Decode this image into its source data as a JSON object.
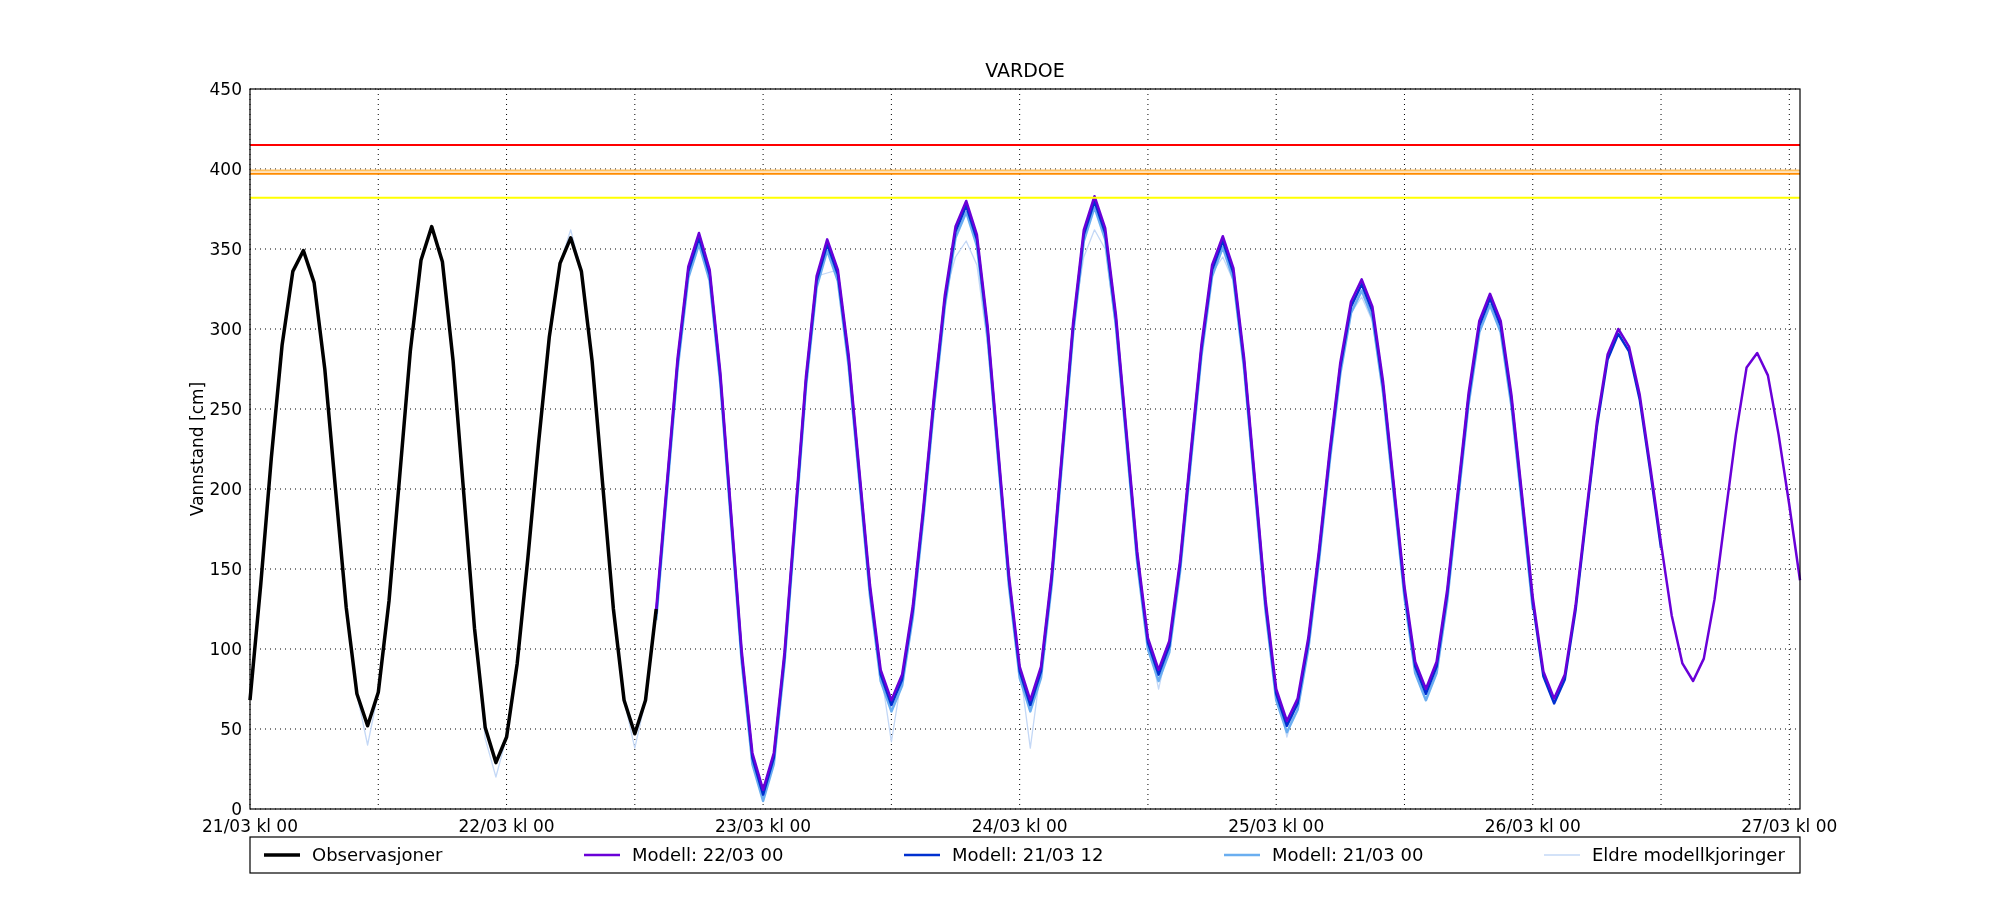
{
  "chart_data": {
    "type": "line",
    "title": "VARDOE",
    "ylabel": "Vannstand [cm]",
    "categories": [
      "21/03 kl 00",
      null,
      null,
      null,
      null,
      null,
      null,
      null,
      null,
      null,
      null,
      null,
      null,
      null,
      null,
      null,
      null,
      null,
      null,
      null,
      null,
      null,
      null,
      null,
      "22/03 kl 00",
      null,
      null,
      null,
      null,
      null,
      null,
      null,
      null,
      null,
      null,
      null,
      null,
      null,
      null,
      null,
      null,
      null,
      null,
      null,
      null,
      null,
      null,
      null,
      "23/03 kl 00",
      null,
      null,
      null,
      null,
      null,
      null,
      null,
      null,
      null,
      null,
      null,
      null,
      null,
      null,
      null,
      null,
      null,
      null,
      null,
      null,
      null,
      null,
      null,
      "24/03 kl 00",
      null,
      null,
      null,
      null,
      null,
      null,
      null,
      null,
      null,
      null,
      null,
      null,
      null,
      null,
      null,
      null,
      null,
      null,
      null,
      null,
      null,
      null,
      null,
      "25/03 kl 00",
      null,
      null,
      null,
      null,
      null,
      null,
      null,
      null,
      null,
      null,
      null,
      null,
      null,
      null,
      null,
      null,
      null,
      null,
      null,
      null,
      null,
      null,
      null,
      "26/03 kl 00",
      null,
      null,
      null,
      null,
      null,
      null,
      null,
      null,
      null,
      null,
      null,
      null,
      null,
      null,
      null,
      null,
      null,
      null,
      null,
      null,
      null,
      null,
      null,
      "27/03 kl 00",
      null
    ],
    "ylim": [
      0,
      450
    ],
    "yticks": [
      0,
      50,
      100,
      150,
      200,
      250,
      300,
      350,
      400,
      450
    ],
    "grid": true,
    "legend": "below",
    "ref_lines": [
      {
        "axis": "y",
        "value": 415,
        "color": "#ff0000"
      },
      {
        "axis": "y",
        "value": 399,
        "color": "#ffc060"
      },
      {
        "axis": "y",
        "value": 397,
        "color": "#ff8c00"
      },
      {
        "axis": "y",
        "value": 382,
        "color": "#ffff00"
      }
    ],
    "series": [
      {
        "name": "Observasjoner",
        "color": "#000000",
        "values": [
          68,
          140,
          220,
          290,
          336,
          349,
          329,
          275,
          200,
          126,
          72,
          52,
          73,
          130,
          208,
          286,
          343,
          364,
          342,
          280,
          197,
          113,
          51,
          29,
          45,
          91,
          157,
          229,
          295,
          341,
          357,
          336,
          280,
          202,
          125,
          68,
          47,
          68,
          125,
          null,
          null,
          null,
          null,
          null,
          null,
          null,
          null,
          null,
          null,
          null,
          null,
          null,
          null,
          null,
          null,
          null,
          null,
          null,
          null,
          null,
          null,
          null,
          null,
          null,
          null,
          null,
          null,
          null,
          null,
          null,
          null,
          null,
          null,
          null,
          null,
          null,
          null,
          null,
          null,
          null,
          null,
          null,
          null,
          null,
          null,
          null,
          null,
          null,
          null,
          null,
          null,
          null,
          null,
          null,
          null,
          null,
          null,
          null,
          null,
          null,
          null,
          null,
          null,
          null,
          null,
          null,
          null,
          null,
          null,
          null,
          null,
          null,
          null,
          null,
          null,
          null,
          null,
          null,
          null,
          null,
          null,
          null,
          null,
          null,
          null,
          null,
          null,
          null,
          null,
          null,
          null,
          null,
          null,
          null,
          null,
          null,
          null,
          null,
          null,
          null,
          null,
          null,
          null,
          null,
          null,
          null
        ]
      },
      {
        "name": "Modell: 22/03 00",
        "color": "#6a00d8",
        "values": [
          null,
          null,
          null,
          null,
          null,
          null,
          null,
          null,
          null,
          null,
          null,
          null,
          null,
          null,
          null,
          null,
          null,
          null,
          null,
          null,
          null,
          null,
          null,
          null,
          null,
          null,
          null,
          null,
          null,
          null,
          null,
          null,
          null,
          null,
          null,
          null,
          null,
          null,
          125,
          204,
          282,
          339,
          360,
          337,
          273,
          186,
          99,
          35,
          12,
          35,
          98,
          184,
          270,
          333,
          356,
          337,
          284,
          212,
          140,
          87,
          68,
          84,
          127,
          189,
          259,
          321,
          364,
          380,
          359,
          302,
          224,
          146,
          89,
          68,
          89,
          147,
          226,
          304,
          362,
          383,
          363,
          309,
          235,
          161,
          107,
          87,
          105,
          155,
          223,
          290,
          340,
          358,
          338,
          282,
          207,
          131,
          75,
          55,
          69,
          107,
          162,
          224,
          279,
          317,
          331,
          314,
          267,
          203,
          139,
          92,
          75,
          92,
          137,
          199,
          260,
          305,
          322,
          305,
          259,
          196,
          132,
          86,
          69,
          84,
          127,
          185,
          242,
          284,
          300,
          289,
          259,
          214,
          166,
          121,
          91,
          80,
          94,
          131,
          183,
          234,
          276,
          285,
          271,
          234,
          190,
          143
        ]
      },
      {
        "name": "Modell: 21/03 12",
        "color": "#0030d0",
        "values": [
          null,
          null,
          null,
          null,
          null,
          null,
          null,
          null,
          null,
          null,
          null,
          null,
          null,
          null,
          null,
          null,
          null,
          null,
          null,
          null,
          null,
          null,
          null,
          null,
          null,
          null,
          null,
          null,
          null,
          null,
          null,
          null,
          null,
          null,
          null,
          null,
          null,
          null,
          122,
          201,
          279,
          336,
          357,
          334,
          270,
          183,
          96,
          32,
          9,
          32,
          95,
          181,
          267,
          330,
          353,
          334,
          281,
          209,
          137,
          84,
          65,
          81,
          124,
          186,
          256,
          318,
          361,
          377,
          356,
          299,
          221,
          143,
          86,
          65,
          86,
          144,
          223,
          301,
          359,
          380,
          360,
          306,
          232,
          158,
          104,
          84,
          102,
          152,
          220,
          287,
          337,
          355,
          335,
          279,
          204,
          128,
          72,
          52,
          66,
          104,
          159,
          221,
          276,
          314,
          328,
          311,
          264,
          200,
          136,
          89,
          72,
          89,
          134,
          196,
          257,
          302,
          319,
          302,
          256,
          193,
          129,
          83,
          66,
          81,
          124,
          182,
          239,
          281,
          297,
          286,
          256,
          211,
          163,
          null,
          null,
          null,
          null,
          null,
          null,
          null,
          null,
          null,
          null,
          null,
          null,
          null
        ]
      },
      {
        "name": "Modell: 21/03 00",
        "color": "#6aaef0",
        "values": [
          null,
          null,
          null,
          null,
          null,
          null,
          null,
          null,
          null,
          null,
          null,
          null,
          null,
          null,
          null,
          null,
          null,
          null,
          null,
          null,
          null,
          null,
          null,
          null,
          null,
          null,
          null,
          null,
          null,
          null,
          null,
          null,
          null,
          null,
          null,
          null,
          null,
          null,
          118,
          197,
          275,
          332,
          353,
          330,
          266,
          179,
          92,
          28,
          5,
          28,
          91,
          177,
          263,
          326,
          349,
          330,
          277,
          205,
          133,
          80,
          61,
          77,
          120,
          182,
          252,
          314,
          357,
          373,
          352,
          295,
          217,
          139,
          82,
          61,
          82,
          140,
          219,
          297,
          355,
          376,
          356,
          302,
          228,
          154,
          100,
          80,
          98,
          148,
          216,
          283,
          333,
          351,
          331,
          275,
          200,
          124,
          68,
          48,
          62,
          100,
          155,
          217,
          272,
          310,
          324,
          307,
          260,
          196,
          132,
          85,
          68,
          85,
          130,
          192,
          253,
          298,
          315,
          298,
          252,
          189,
          125,
          null,
          null,
          null,
          null,
          null,
          null,
          null,
          null,
          null,
          null,
          null,
          null,
          null,
          null,
          null,
          null,
          null,
          null,
          null,
          null,
          null,
          null,
          null,
          null,
          null
        ]
      },
      {
        "name": "Eldre modellkjoringer",
        "color": "#c4d8f6",
        "values": [
          null,
          null,
          null,
          null,
          null,
          null,
          null,
          null,
          null,
          126,
          72,
          40,
          73,
          130,
          208,
          286,
          343,
          364,
          342,
          280,
          197,
          113,
          44,
          20,
          45,
          91,
          157,
          229,
          295,
          341,
          362,
          336,
          280,
          202,
          125,
          68,
          38,
          68,
          125,
          204,
          282,
          339,
          360,
          337,
          273,
          186,
          99,
          35,
          5,
          35,
          98,
          184,
          270,
          333,
          335,
          337,
          284,
          212,
          140,
          87,
          42,
          84,
          127,
          189,
          259,
          321,
          345,
          355,
          340,
          290,
          224,
          146,
          89,
          38,
          89,
          147,
          226,
          304,
          345,
          362,
          350,
          300,
          235,
          161,
          107,
          75,
          105,
          155,
          223,
          290,
          335,
          345,
          330,
          282,
          207,
          131,
          75,
          45,
          69,
          107,
          162,
          224,
          279,
          310,
          320,
          305,
          260,
          203,
          139,
          null,
          null,
          null,
          null,
          null,
          null,
          null,
          null,
          null,
          null,
          null,
          null,
          null,
          null,
          null,
          null,
          null,
          null,
          null,
          null,
          null,
          null,
          null,
          null,
          null,
          null,
          null,
          null,
          null,
          null,
          null,
          null,
          null,
          null,
          null,
          null,
          null
        ]
      }
    ]
  }
}
